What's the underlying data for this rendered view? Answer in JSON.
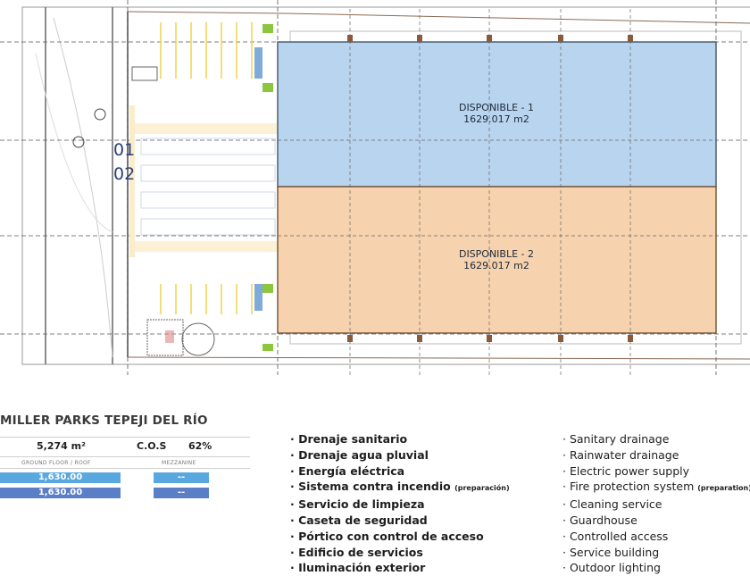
{
  "plan": {
    "bay_numbers": [
      "01",
      "02"
    ],
    "units": [
      {
        "name": "DISPONIBLE - 1",
        "area": "1629.017 m2",
        "color": "#b9d4ef"
      },
      {
        "name": "DISPONIBLE - 2",
        "area": "1629.017 m2",
        "color": "#f6d2ae"
      }
    ],
    "accent_colors": {
      "parking_lines": "#f2d55a",
      "green_areas": "#8cc63f",
      "ramps": "#4a86c8",
      "wall": "#7a5a3c"
    }
  },
  "summary": {
    "title": "MILLER PARKS TEPEJI DEL RÍO",
    "total_area": "5,274 m²",
    "cos_label": "C.O.S",
    "cos_value": "62%",
    "col_ground": "GROUND FLOOR / ROOF",
    "col_mezzanine": "MEZZANINE",
    "rows": [
      {
        "ground": "1,630.00",
        "mezzanine": "--",
        "color": "#5aa8e0"
      },
      {
        "ground": "1,630.00",
        "mezzanine": "--",
        "color": "#5b7fc7"
      }
    ]
  },
  "amenities_es": [
    {
      "text": "· Drenaje sanitario"
    },
    {
      "text": "· Drenaje agua pluvial"
    },
    {
      "text": "· Energía eléctrica"
    },
    {
      "text": "· Sistema contra incendio",
      "note": "(preparación)"
    },
    {
      "text": "· Servicio de limpieza"
    },
    {
      "text": "· Caseta de seguridad"
    },
    {
      "text": "· Pórtico con control de acceso"
    },
    {
      "text": "· Edificio de servicios"
    },
    {
      "text": "· Iluminación exterior"
    }
  ],
  "amenities_en": [
    {
      "text": "· Sanitary drainage"
    },
    {
      "text": "· Rainwater drainage"
    },
    {
      "text": "· Electric power supply"
    },
    {
      "text": "· Fire protection system",
      "note": "(preparation)"
    },
    {
      "text": "· Cleaning service"
    },
    {
      "text": "· Guardhouse"
    },
    {
      "text": "· Controlled access"
    },
    {
      "text": "· Service building"
    },
    {
      "text": "· Outdoor lighting"
    }
  ]
}
